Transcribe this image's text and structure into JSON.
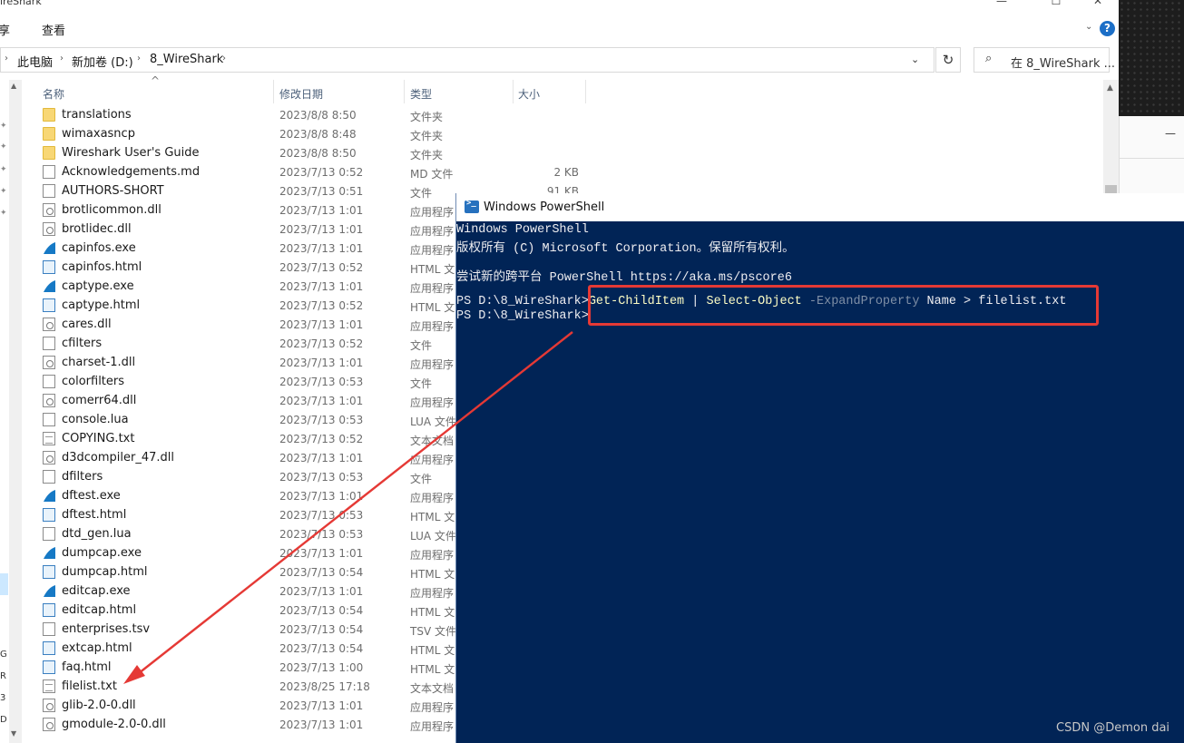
{
  "explorer": {
    "title": "ireShark",
    "window_controls": [
      "—",
      "☐",
      "✕"
    ],
    "ribbon": {
      "tabs": [
        "共享",
        "查看"
      ],
      "tab_share_visible": "享",
      "help": "?"
    },
    "address": {
      "crumbs": [
        "此电脑",
        "新加卷 (D:)",
        "8_WireShark"
      ],
      "separator": "›",
      "dropdown": "⌄"
    },
    "refresh_icon": "↻",
    "search": {
      "icon": "search-icon",
      "placeholder": "在 8_WireShark ..."
    },
    "columns": {
      "name": "名称",
      "modified": "修改日期",
      "type": "类型",
      "size": "大小"
    },
    "nav_letters": [
      "G",
      "R",
      "3",
      "D"
    ],
    "files": [
      {
        "name": "translations",
        "date": "2023/8/8 8:50",
        "type": "文件夹",
        "size": "",
        "icon": "folder"
      },
      {
        "name": "wimaxasncp",
        "date": "2023/8/8 8:48",
        "type": "文件夹",
        "size": "",
        "icon": "folder"
      },
      {
        "name": "Wireshark User's Guide",
        "date": "2023/8/8 8:50",
        "type": "文件夹",
        "size": "",
        "icon": "folder"
      },
      {
        "name": "Acknowledgements.md",
        "date": "2023/7/13 0:52",
        "type": "MD 文件",
        "size": "2 KB",
        "icon": "file"
      },
      {
        "name": "AUTHORS-SHORT",
        "date": "2023/7/13 0:51",
        "type": "文件",
        "size": "91 KB",
        "icon": "file"
      },
      {
        "name": "brotlicommon.dll",
        "date": "2023/7/13 1:01",
        "type": "应用程序",
        "size": "",
        "icon": "dll"
      },
      {
        "name": "brotlidec.dll",
        "date": "2023/7/13 1:01",
        "type": "应用程序",
        "size": "",
        "icon": "dll"
      },
      {
        "name": "capinfos.exe",
        "date": "2023/7/13 1:01",
        "type": "应用程序",
        "size": "",
        "icon": "exe"
      },
      {
        "name": "capinfos.html",
        "date": "2023/7/13 0:52",
        "type": "HTML 文",
        "size": "",
        "icon": "html"
      },
      {
        "name": "captype.exe",
        "date": "2023/7/13 1:01",
        "type": "应用程序",
        "size": "",
        "icon": "exe"
      },
      {
        "name": "captype.html",
        "date": "2023/7/13 0:52",
        "type": "HTML 文",
        "size": "",
        "icon": "html"
      },
      {
        "name": "cares.dll",
        "date": "2023/7/13 1:01",
        "type": "应用程序",
        "size": "",
        "icon": "dll"
      },
      {
        "name": "cfilters",
        "date": "2023/7/13 0:52",
        "type": "文件",
        "size": "",
        "icon": "file"
      },
      {
        "name": "charset-1.dll",
        "date": "2023/7/13 1:01",
        "type": "应用程序",
        "size": "",
        "icon": "dll"
      },
      {
        "name": "colorfilters",
        "date": "2023/7/13 0:53",
        "type": "文件",
        "size": "",
        "icon": "file"
      },
      {
        "name": "comerr64.dll",
        "date": "2023/7/13 1:01",
        "type": "应用程序",
        "size": "",
        "icon": "dll"
      },
      {
        "name": "console.lua",
        "date": "2023/7/13 0:53",
        "type": "LUA 文件",
        "size": "",
        "icon": "file"
      },
      {
        "name": "COPYING.txt",
        "date": "2023/7/13 0:52",
        "type": "文本文档",
        "size": "",
        "icon": "txt"
      },
      {
        "name": "d3dcompiler_47.dll",
        "date": "2023/7/13 1:01",
        "type": "应用程序",
        "size": "",
        "icon": "dll"
      },
      {
        "name": "dfilters",
        "date": "2023/7/13 0:53",
        "type": "文件",
        "size": "",
        "icon": "file"
      },
      {
        "name": "dftest.exe",
        "date": "2023/7/13 1:01",
        "type": "应用程序",
        "size": "",
        "icon": "exe"
      },
      {
        "name": "dftest.html",
        "date": "2023/7/13 0:53",
        "type": "HTML 文",
        "size": "",
        "icon": "html"
      },
      {
        "name": "dtd_gen.lua",
        "date": "2023/7/13 0:53",
        "type": "LUA 文件",
        "size": "",
        "icon": "file"
      },
      {
        "name": "dumpcap.exe",
        "date": "2023/7/13 1:01",
        "type": "应用程序",
        "size": "",
        "icon": "exe"
      },
      {
        "name": "dumpcap.html",
        "date": "2023/7/13 0:54",
        "type": "HTML 文",
        "size": "",
        "icon": "html"
      },
      {
        "name": "editcap.exe",
        "date": "2023/7/13 1:01",
        "type": "应用程序",
        "size": "",
        "icon": "exe"
      },
      {
        "name": "editcap.html",
        "date": "2023/7/13 0:54",
        "type": "HTML 文",
        "size": "",
        "icon": "html"
      },
      {
        "name": "enterprises.tsv",
        "date": "2023/7/13 0:54",
        "type": "TSV 文件",
        "size": "",
        "icon": "file"
      },
      {
        "name": "extcap.html",
        "date": "2023/7/13 0:54",
        "type": "HTML 文",
        "size": "",
        "icon": "html"
      },
      {
        "name": "faq.html",
        "date": "2023/7/13 1:00",
        "type": "HTML 文",
        "size": "",
        "icon": "html"
      },
      {
        "name": "filelist.txt",
        "date": "2023/8/25 17:18",
        "type": "文本文档",
        "size": "",
        "icon": "txt"
      },
      {
        "name": "glib-2.0-0.dll",
        "date": "2023/7/13 1:01",
        "type": "应用程序",
        "size": "",
        "icon": "dll"
      },
      {
        "name": "gmodule-2.0-0.dll",
        "date": "2023/7/13 1:01",
        "type": "应用程序",
        "size": "",
        "icon": "dll"
      }
    ]
  },
  "powershell": {
    "title": "Windows PowerShell",
    "lines": {
      "l1": "Windows PowerShell",
      "l2": "版权所有 (C) Microsoft Corporation。保留所有权利。",
      "l3": "尝试新的跨平台 PowerShell https://aka.ms/pscore6",
      "prompt": "PS D:\\8_WireShark>",
      "cmd_name": "Get-ChildItem",
      "pipe": " | ",
      "cmd2": "Select-Object",
      "param": "-ExpandProperty",
      "arg": " Name > filelist.txt"
    }
  },
  "annotation": {
    "box_color": "#e53935",
    "arrow_color": "#e53935"
  },
  "watermark": "CSDN @Demon dai",
  "colors": {
    "ps_bg": "#012456",
    "folder": "#f8d775",
    "accent": "#1c6fc7"
  }
}
